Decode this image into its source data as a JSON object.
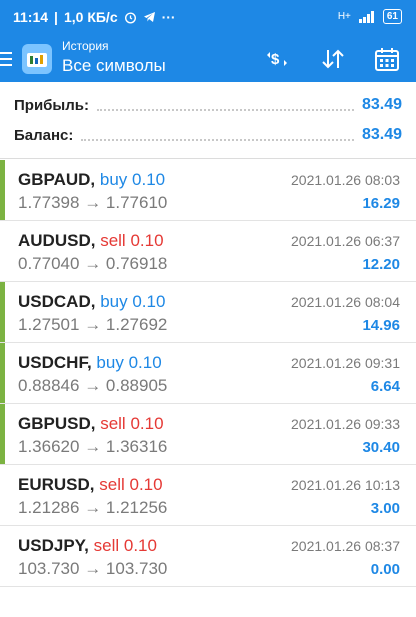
{
  "status_bar": {
    "time": "11:14",
    "speed": "1,0 КБ/с",
    "dots": "···",
    "signal": "H+",
    "battery": "61"
  },
  "app_bar": {
    "subtitle": "История",
    "title": "Все символы",
    "icons": [
      "menu-icon",
      "app-logo",
      "currency-exchange-icon",
      "sort-icon",
      "calendar-icon"
    ]
  },
  "summary": {
    "profit_label": "Прибыль:",
    "profit_value": "83.49",
    "balance_label": "Баланс:",
    "balance_value": "83.49"
  },
  "deals": [
    {
      "symbol": "GBPAUD,",
      "type": "buy",
      "volume": "0.10",
      "open": "1.77398",
      "arrow": "→",
      "close": "1.77610",
      "time": "2021.01.26 08:03",
      "profit": "16.29",
      "accent": true
    },
    {
      "symbol": "AUDUSD,",
      "type": "sell",
      "volume": "0.10",
      "open": "0.77040",
      "arrow": "→",
      "close": "0.76918",
      "time": "2021.01.26 06:37",
      "profit": "12.20",
      "accent": false
    },
    {
      "symbol": "USDCAD,",
      "type": "buy",
      "volume": "0.10",
      "open": "1.27501",
      "arrow": "→",
      "close": "1.27692",
      "time": "2021.01.26 08:04",
      "profit": "14.96",
      "accent": true
    },
    {
      "symbol": "USDCHF,",
      "type": "buy",
      "volume": "0.10",
      "open": "0.88846",
      "arrow": "→",
      "close": "0.88905",
      "time": "2021.01.26 09:31",
      "profit": "6.64",
      "accent": true
    },
    {
      "symbol": "GBPUSD,",
      "type": "sell",
      "volume": "0.10",
      "open": "1.36620",
      "arrow": "→",
      "close": "1.36316",
      "time": "2021.01.26 09:33",
      "profit": "30.40",
      "accent": true
    },
    {
      "symbol": "EURUSD,",
      "type": "sell",
      "volume": "0.10",
      "open": "1.21286",
      "arrow": "→",
      "close": "1.21256",
      "time": "2021.01.26 10:13",
      "profit": "3.00",
      "accent": false
    },
    {
      "symbol": "USDJPY,",
      "type": "sell",
      "volume": "0.10",
      "open": "103.730",
      "arrow": "→",
      "close": "103.730",
      "time": "2021.01.26 08:37",
      "profit": "0.00",
      "accent": false
    }
  ],
  "colors": {
    "brand": "#1e88e5",
    "buy": "#1e88e5",
    "sell": "#e53935",
    "profit_accent": "#7cb342"
  }
}
